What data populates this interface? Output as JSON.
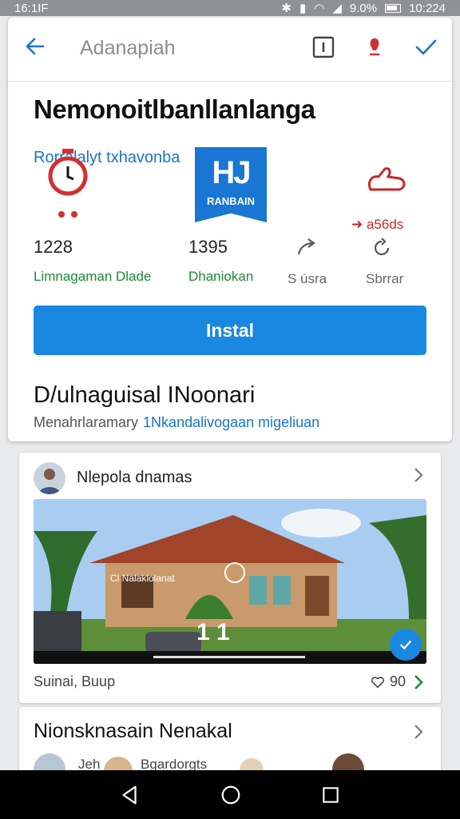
{
  "status_bar": {
    "time": "16:1IF",
    "battery": "9.0%",
    "clock": "10:224"
  },
  "toolbar": {
    "title": "Adanapiah"
  },
  "app": {
    "title": "Nemonoitlbanllanlanga",
    "subtitle": "Rorralalyt txhavonba",
    "logo_big_text": "HJ",
    "logo_small_text": "RANBAIN",
    "badge_text": "➜ a56ds"
  },
  "stats": [
    {
      "value": "1228",
      "label": "Limnagaman Dlade"
    },
    {
      "value": "1395",
      "label": "Dhaniokan"
    },
    {
      "value": "",
      "label": "S úsra"
    },
    {
      "value": "",
      "label": "Sbrrar"
    }
  ],
  "install_label": "Instal",
  "section": {
    "title": "D/ulnaguisal INoonari",
    "sub": "Menahrlaramary",
    "sub_link": "1Nkandalivogaan migeliuan"
  },
  "post": {
    "name": "Nlepola dnamas",
    "image_caption": "Cl Nalaklolanat",
    "image_overlay": "1 1",
    "footer_left": "Suinai, Buup",
    "footer_count": "90"
  },
  "people": {
    "title": "Nionsknasain Nenakal",
    "row_label": "Jeh",
    "row_text": "Bgardorgts"
  },
  "colors": {
    "accent": "#1a88e0",
    "link": "#1a73c8",
    "red": "#d32f2f",
    "green": "#1b8a3a"
  }
}
